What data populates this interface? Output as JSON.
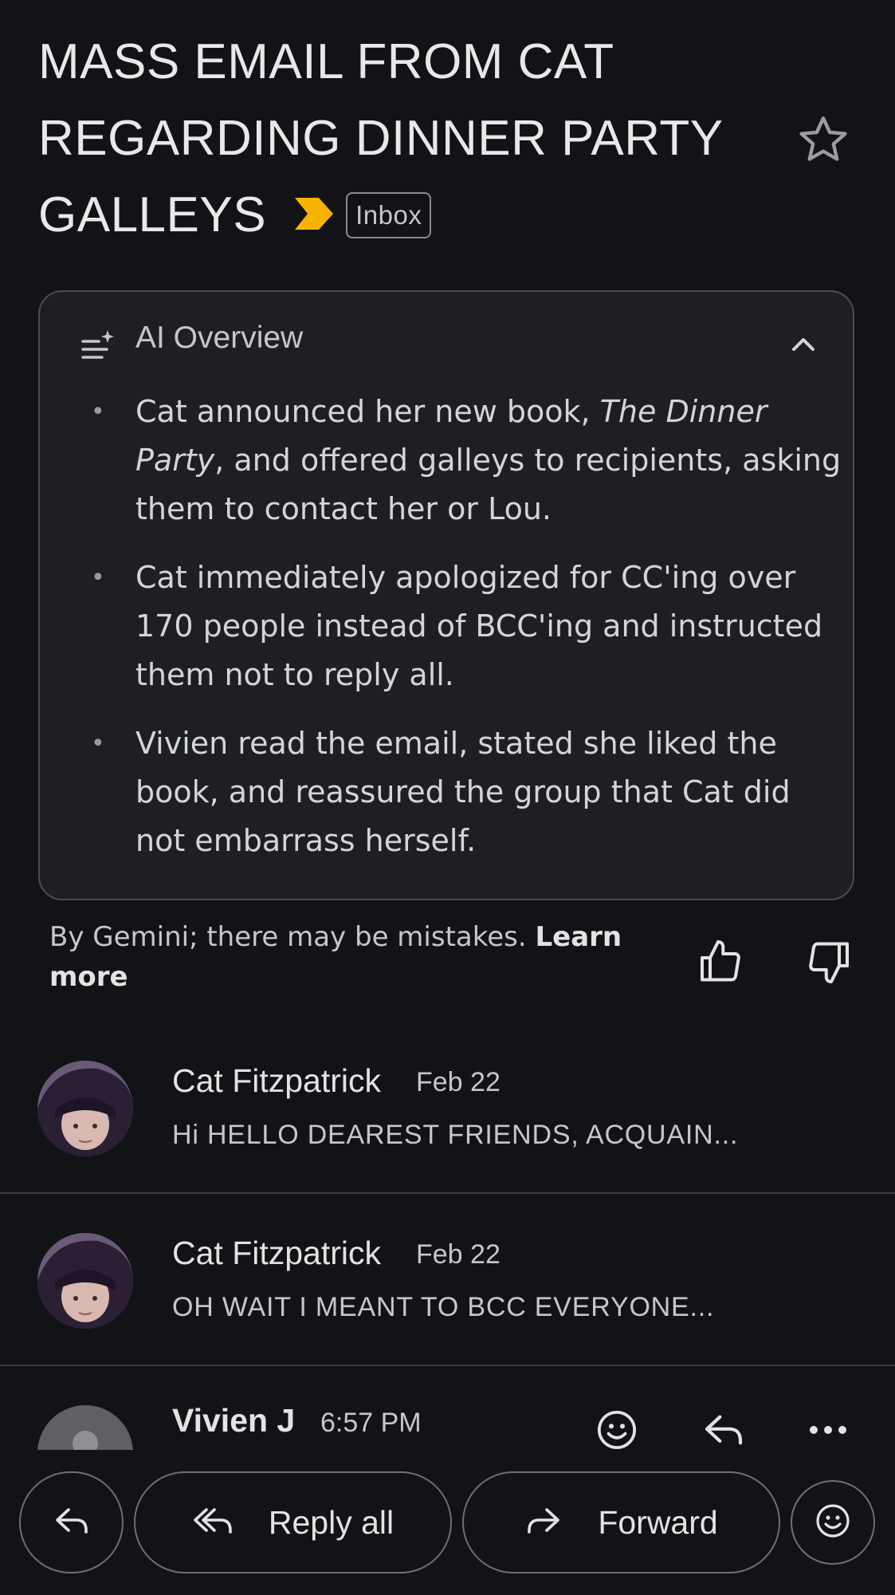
{
  "subject": {
    "line1": "MASS EMAIL FROM CAT",
    "line2": "REGARDING DINNER PARTY",
    "line3": "GALLEYS",
    "label": "Inbox"
  },
  "ai_overview": {
    "title": "AI Overview",
    "bullets": [
      {
        "pre": "Cat announced her new book, ",
        "italic": "The Dinner Party",
        "post": ", and offered galleys to recipients, asking them to contact her or Lou."
      },
      {
        "text": "Cat immediately apologized for CC'ing over 170 people instead of BCC'ing and instructed them not to reply all."
      },
      {
        "text": "Vivien read the email, stated she liked the book, and reassured the group that Cat did not embarrass herself."
      }
    ],
    "bullet_char": "•"
  },
  "disclaimer": {
    "text": "By Gemini; there may be mistakes. ",
    "link": "Learn more"
  },
  "messages": [
    {
      "sender": "Cat Fitzpatrick",
      "date": "Feb 22",
      "snippet": "Hi HELLO DEAREST FRIENDS, ACQUAIN..."
    },
    {
      "sender": "Cat Fitzpatrick",
      "date": "Feb 22",
      "snippet": "OH WAIT I MEANT TO BCC EVERYONE..."
    },
    {
      "sender": "Vivien J",
      "date": "6:57 PM"
    }
  ],
  "actions": {
    "reply_all": "Reply all",
    "forward": "Forward"
  },
  "colors": {
    "background": "#121316",
    "card": "#1e1f22",
    "important_marker": "#f6b400"
  },
  "icons": [
    "star-icon",
    "ai-overview-icon",
    "chevron-up-icon",
    "thumbs-up-icon",
    "thumbs-down-icon",
    "emoji-icon",
    "reply-icon",
    "more-icon",
    "reply-all-icon",
    "forward-icon"
  ]
}
